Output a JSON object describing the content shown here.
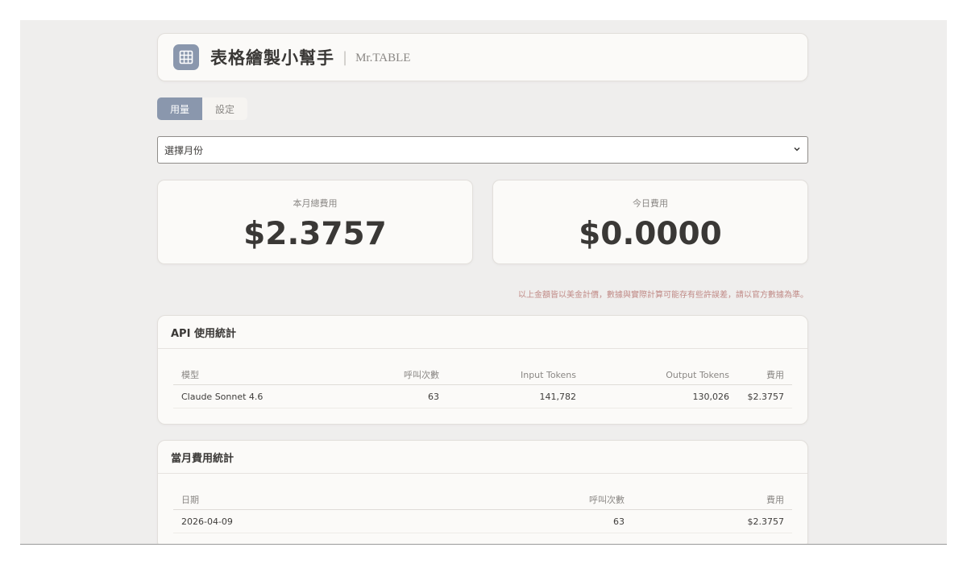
{
  "header": {
    "title": "表格繪製小幫手",
    "divider": "|",
    "subtitle": "Mr.TABLE",
    "logo_icon": "table-grid-icon"
  },
  "tabs": [
    {
      "label": "用量",
      "active": true
    },
    {
      "label": "設定",
      "active": false
    }
  ],
  "month_select": {
    "value": "選擇月份"
  },
  "stats": {
    "month_total": {
      "label": "本月總費用",
      "value": "$2.3757"
    },
    "today": {
      "label": "今日費用",
      "value": "$0.0000"
    }
  },
  "note": "以上金額皆以美金計價，數據與實際計算可能存有些許誤差，請以官方數據為準。",
  "api_stats": {
    "title": "API 使用統計",
    "columns": [
      "模型",
      "呼叫次數",
      "Input Tokens",
      "Output Tokens",
      "費用"
    ],
    "rows": [
      [
        "Claude Sonnet 4.6",
        "63",
        "141,782",
        "130,026",
        "$2.3757"
      ]
    ]
  },
  "monthly_stats": {
    "title": "當月費用統計",
    "columns": [
      "日期",
      "呼叫次數",
      "費用"
    ],
    "rows": [
      [
        "2026-04-09",
        "63",
        "$2.3757"
      ]
    ]
  },
  "colors": {
    "accent": "#8a97ad",
    "note": "#c08a86",
    "background": "#efeeed",
    "card": "#fbfaf8"
  }
}
